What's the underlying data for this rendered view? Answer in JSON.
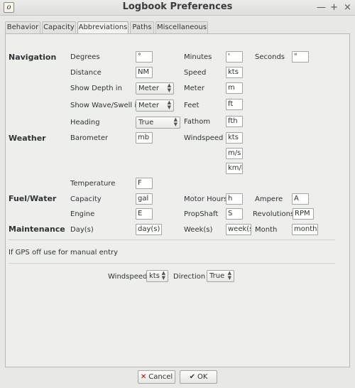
{
  "window": {
    "title": "Logbook Preferences",
    "icon_letter": "o",
    "min_glyph": "—",
    "max_glyph": "+",
    "close_glyph": "×"
  },
  "tabs": [
    "Behavior",
    "Capacity",
    "Abbreviations",
    "Paths",
    "Miscellaneous"
  ],
  "sections": {
    "navigation": "Navigation",
    "weather": "Weather",
    "fuel_water": "Fuel/Water",
    "maintenance": "Maintenance"
  },
  "labels": {
    "degrees": "Degrees",
    "minutes": "Minutes",
    "seconds": "Seconds",
    "distance": "Distance",
    "speed": "Speed",
    "show_depth_in": "Show Depth in",
    "meter": "Meter",
    "show_wave_swell_in": "Show Wave/Swell in",
    "feet": "Feet",
    "heading": "Heading",
    "fathom": "Fathom",
    "barometer": "Barometer",
    "windspeed": "Windspeed",
    "temperature": "Temperature",
    "capacity": "Capacity",
    "motor_hours": "Motor Hours",
    "ampere": "Ampere",
    "engine": "Engine",
    "propshaft": "PropShaft",
    "revolutions": "Revolutions",
    "days": "Day(s)",
    "weeks": "Week(s)",
    "month": "Month"
  },
  "fields": {
    "degrees": "°",
    "minutes": "'",
    "seconds": "\"",
    "distance": "NM",
    "speed": "kts",
    "meter": "m",
    "feet": "ft",
    "fathom": "fth",
    "barometer": "mb",
    "windspeed_1": "kts",
    "windspeed_2": "m/s",
    "windspeed_3": "km/h",
    "temperature": "F",
    "capacity": "gal",
    "motor_hours": "h",
    "ampere": "A",
    "engine": "E",
    "propshaft": "S",
    "revolutions": "RPM",
    "days": "day(s)",
    "weeks": "week(s)",
    "month": "month"
  },
  "combos": {
    "show_depth_in": "Meter",
    "show_wave_swell_in": "Meter",
    "heading": "True",
    "gps_windspeed": "kts",
    "gps_direction": "True"
  },
  "gps": {
    "note": "If GPS off use for manual entry",
    "windspeed_label": "Windspeed",
    "direction_label": "Direction"
  },
  "footer": {
    "cancel_label": "Cancel",
    "ok_label": "OK",
    "cancel_glyph": "✕",
    "ok_glyph": "✔"
  }
}
